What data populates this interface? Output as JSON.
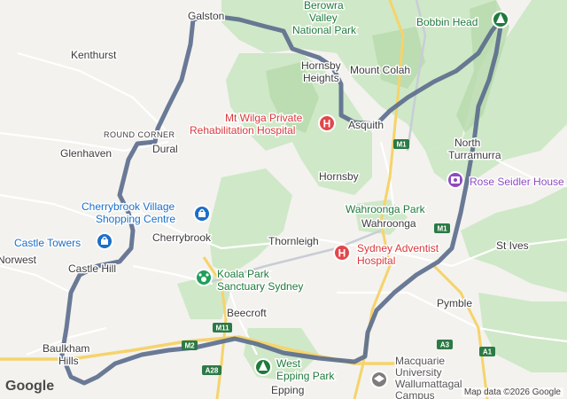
{
  "map": {
    "places": {
      "galston": "Galston",
      "berowra_line1": "Berowra",
      "berowra_line2": "Valley",
      "berowra_line3": "National Park",
      "bobbin_head": "Bobbin Head",
      "kenthurst": "Kenthurst",
      "hornsby_heights_1": "Hornsby",
      "hornsby_heights_2": "Heights",
      "mount_colah": "Mount Colah",
      "mt_wilga_1": "Mt Wilga Private",
      "mt_wilga_2": "Rehabilitation Hospital",
      "asquith": "Asquith",
      "round_corner": "ROUND CORNER",
      "north_turramurra_1": "North",
      "north_turramurra_2": "Turramurra",
      "glenhaven": "Glenhaven",
      "dural": "Dural",
      "rose_seidler": "Rose Seidler House",
      "hornsby": "Hornsby",
      "cherrybrook_village_1": "Cherrybrook Village",
      "cherrybrook_village_2": "Shopping Centre",
      "wahroonga_park": "Wahroonga Park",
      "wahroonga": "Wahroonga",
      "castle_towers": "Castle Towers",
      "cherrybrook": "Cherrybrook",
      "thornleigh": "Thornleigh",
      "sydney_adventist_1": "Sydney Adventist",
      "sydney_adventist_2": "Hospital",
      "st_ives": "St Ives",
      "norwest": "Norwest",
      "castle_hill": "Castle Hill",
      "koala_park_1": "Koala Park",
      "koala_park_2": "Sanctuary Sydney",
      "pymble": "Pymble",
      "beecroft": "Beecroft",
      "baulkham_1": "Baulkham",
      "baulkham_2": "Hills",
      "west_epping_1": "West",
      "west_epping_2": "Epping Park",
      "macquarie_1": "Macquarie",
      "macquarie_2": "University",
      "macquarie_3": "Wallumattagal",
      "macquarie_4": "Campus",
      "epping": "Epping"
    },
    "shields": {
      "m1_a": "M1",
      "m1_b": "M1",
      "m2": "M2",
      "m11": "M11",
      "a28": "A28",
      "a3": "A3",
      "a1": "A1"
    },
    "route_color": "#5a6b8c",
    "google_logo": "Google",
    "attribution": "Map data ©2026 Google"
  }
}
